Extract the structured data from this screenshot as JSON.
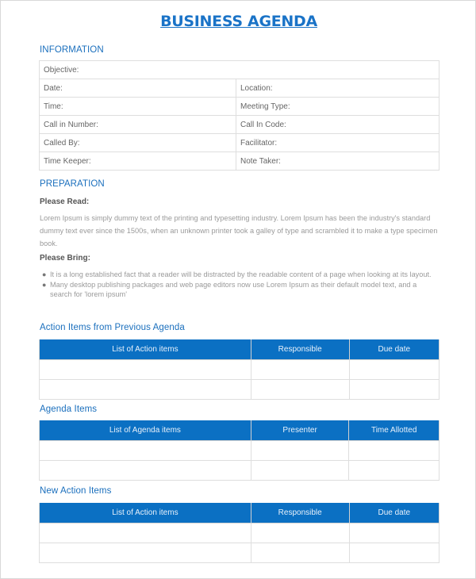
{
  "title": "BUSINESS AGENDA",
  "colors": {
    "accent": "#0b70c3",
    "title": "#1a73c7"
  },
  "information": {
    "heading": "INFORMATION",
    "objective_label": "Objective:",
    "rows": [
      {
        "left": "Date:",
        "right": "Location:"
      },
      {
        "left": "Time:",
        "right": "Meeting Type:"
      },
      {
        "left": "Call in Number:",
        "right": "Call In Code:"
      },
      {
        "left": "Called By:",
        "right": "Facilitator:"
      },
      {
        "left": "Time Keeper:",
        "right": "Note Taker:"
      }
    ]
  },
  "preparation": {
    "heading": "PREPARATION",
    "please_read_label": "Please Read:",
    "please_read_text": "Lorem Ipsum is simply dummy text of the printing and typesetting industry. Lorem Ipsum has been the industry's standard dummy text ever since the 1500s, when an unknown printer took a galley of type and scrambled it to make a type specimen book.",
    "please_bring_label": "Please Bring:",
    "bullets": [
      "It is a long established fact that a reader will be distracted by the readable content of a page when looking at its layout.",
      "Many desktop publishing packages and web page editors now use Lorem Ipsum as their default model text, and a search for 'lorem ipsum'"
    ]
  },
  "previous_actions": {
    "heading": "Action Items from Previous Agenda",
    "columns": [
      "List of Action items",
      "Responsible",
      "Due date"
    ]
  },
  "agenda_items": {
    "heading": "Agenda Items",
    "columns": [
      "List of Agenda items",
      "Presenter",
      "Time Allotted"
    ]
  },
  "new_actions": {
    "heading": "New Action Items",
    "columns": [
      "List of Action items",
      "Responsible",
      "Due date"
    ]
  }
}
